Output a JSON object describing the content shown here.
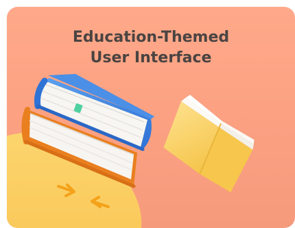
{
  "card": {
    "title_line1": "Education-Themed",
    "title_line2": "User Interface"
  },
  "colors": {
    "background_top": "#ffa98a",
    "background_bottom": "#f69a7c",
    "title": "#4a4442",
    "book_blue": "#3f86e3",
    "book_orange": "#f08a25",
    "book_yellow": "#f7c94a",
    "blob": "#fcd46a",
    "arrows": "#f4a51d"
  },
  "icons": [
    "stacked-books-illustration",
    "open-book-illustration",
    "compress-arrows-icon"
  ]
}
